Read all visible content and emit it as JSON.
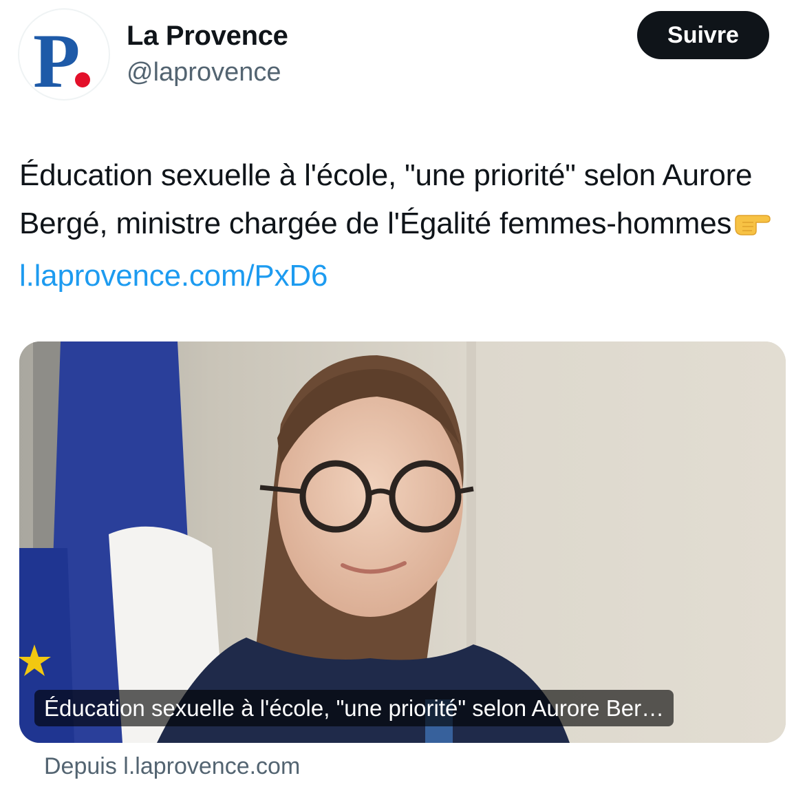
{
  "account": {
    "name": "La Provence",
    "handle": "@laprovence",
    "avatar_letter": "P",
    "brand_color": "#1e5aa8",
    "dot_color": "#e3102a"
  },
  "follow_button": {
    "label": "Suivre"
  },
  "tweet": {
    "text_main": "Éducation sexuelle à l'école, \"une priorité\" selon Aurore Bergé, ministre chargée de l'Égalité femmes-hommes",
    "emoji": "backhand-index-pointing-right",
    "link_text": "l.laprovence.com/PxD6",
    "link_color": "#1d9bf0"
  },
  "card": {
    "caption": "Éducation sexuelle à l'école, \"une priorité\" selon Aurore Ber…",
    "source": "Depuis l.laprovence.com"
  }
}
